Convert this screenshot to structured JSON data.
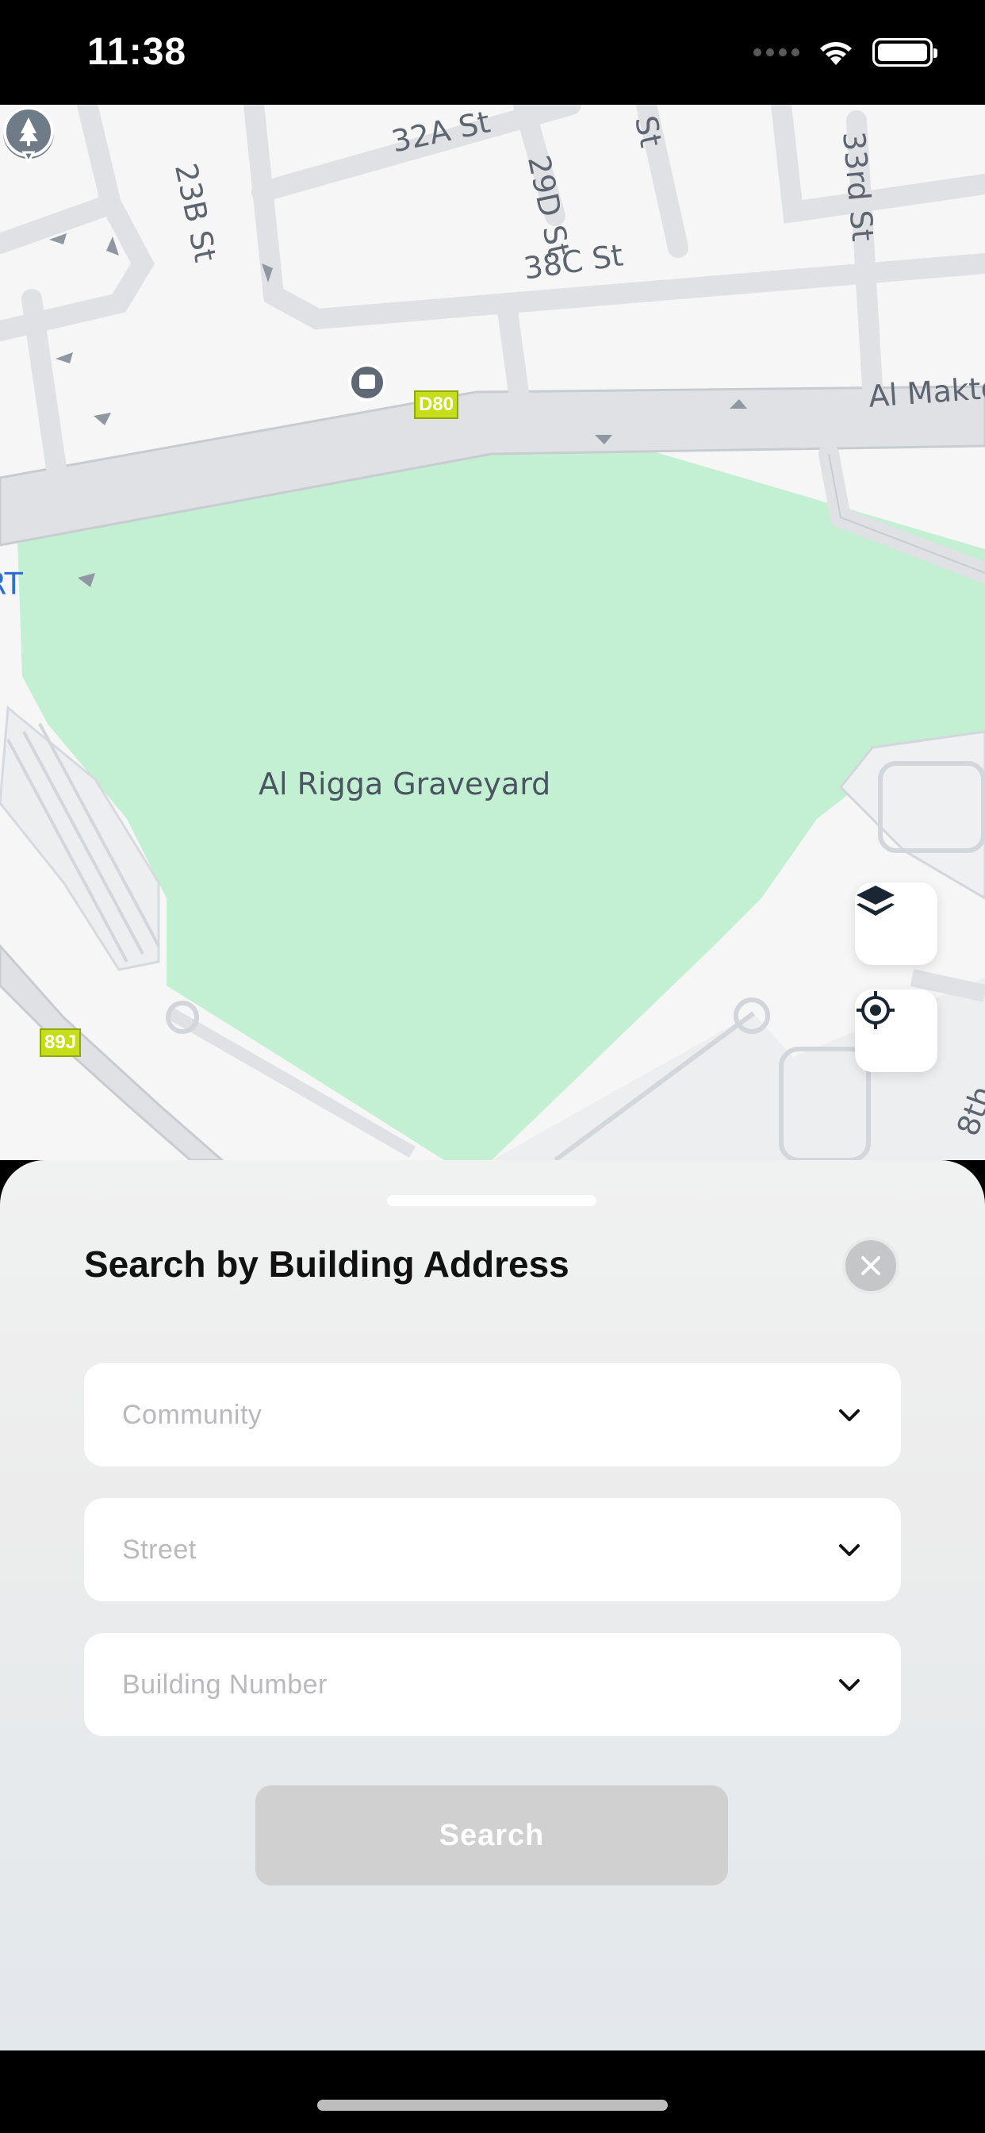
{
  "status_bar": {
    "time": "11:38",
    "signal_icon": "signal-dots-icon",
    "wifi_icon": "wifi-icon",
    "battery_icon": "battery-icon"
  },
  "map": {
    "street_labels": [
      "32A St",
      "23B St",
      "29D St",
      "St",
      "33rd St",
      "38C St",
      "Al Makto",
      "8th",
      "RT"
    ],
    "road_badges": [
      "D80",
      "89J"
    ],
    "poi": {
      "name": "Al Rigga Graveyard",
      "icon": "park-pin-icon"
    },
    "colors": {
      "park": "#c3efd3",
      "road": "#dfe1e4",
      "road_edge": "#c5c9ce",
      "background": "#f6f6f6"
    },
    "controls": {
      "layers_icon": "layers-icon",
      "locate_icon": "locate-icon"
    }
  },
  "sheet": {
    "title": "Search by Building Address",
    "close_icon": "close-icon",
    "fields": [
      {
        "placeholder": "Community",
        "icon": "chevron-down-icon"
      },
      {
        "placeholder": "Street",
        "icon": "chevron-down-icon"
      },
      {
        "placeholder": "Building Number",
        "icon": "chevron-down-icon"
      }
    ],
    "search_label": "Search",
    "search_enabled": false
  }
}
